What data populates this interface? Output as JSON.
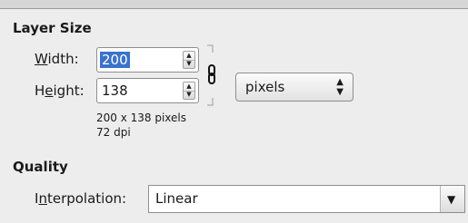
{
  "layer_size": {
    "heading": "Layer Size",
    "width_label_u": "W",
    "width_label_rest": "idth:",
    "width_value": "200",
    "height_label_pre": "H",
    "height_label_u": "e",
    "height_label_rest": "ight:",
    "height_value": "138",
    "unit_value": "pixels",
    "info_size": "200 x 138 pixels",
    "info_dpi": "72 dpi"
  },
  "quality": {
    "heading": "Quality",
    "interp_label_pre": "I",
    "interp_label_u": "n",
    "interp_label_rest": "terpolation:",
    "interp_value": "Linear"
  },
  "icons": {
    "chain": "chain-link-icon",
    "spin_up": "triangle-up",
    "spin_down": "triangle-down",
    "combo": "up-down-arrows",
    "dropdown": "triangle-down"
  },
  "colors": {
    "selection": "#3a72c9",
    "background": "#ededed"
  }
}
